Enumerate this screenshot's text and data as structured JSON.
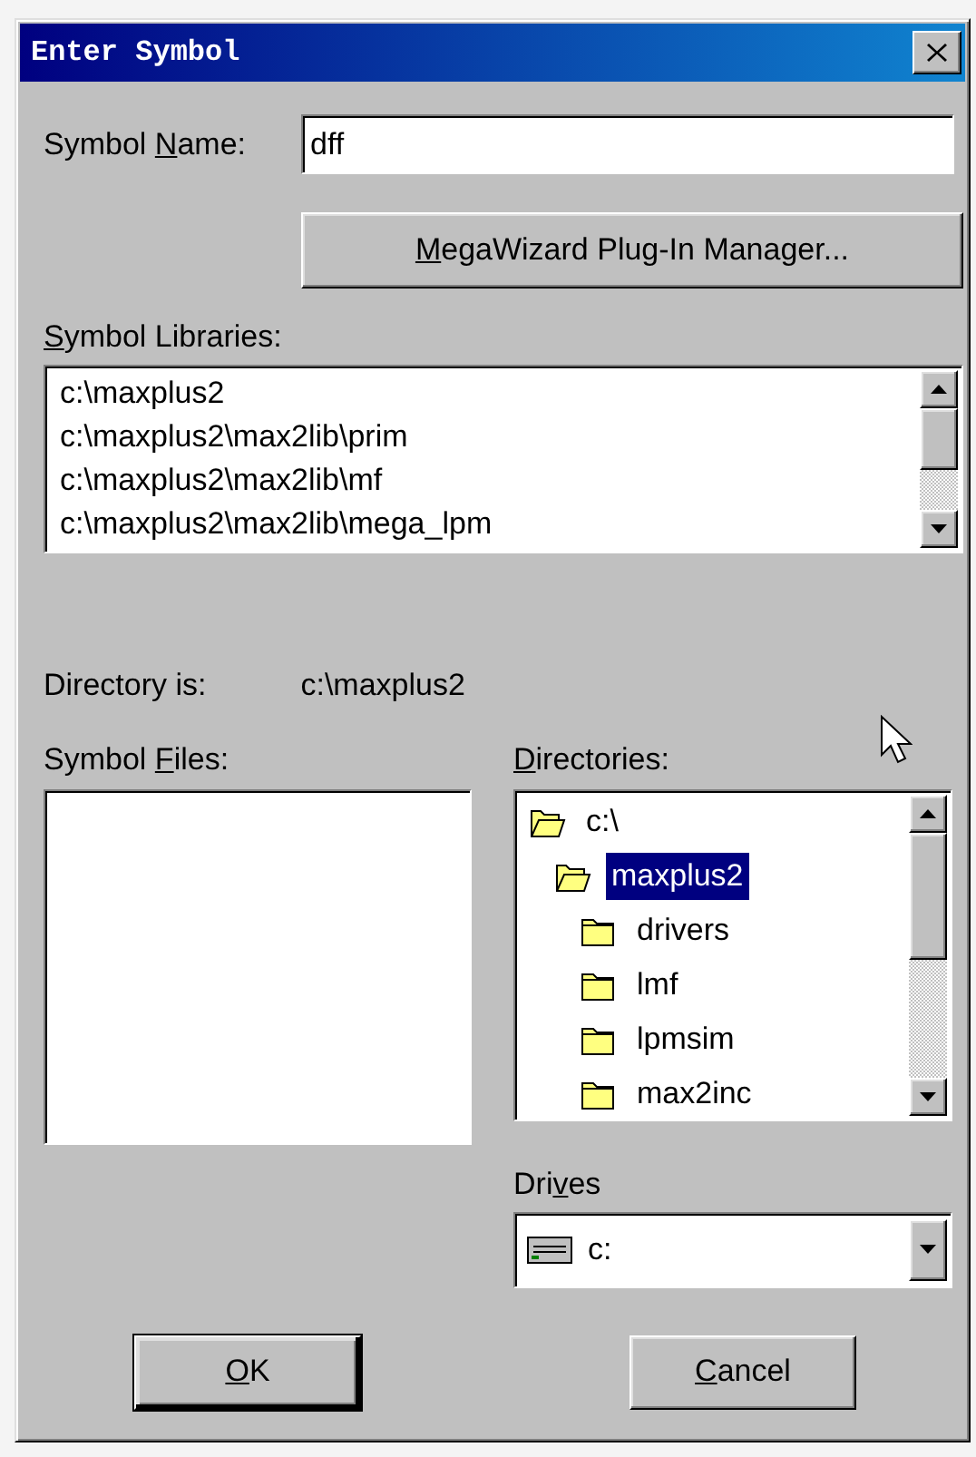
{
  "window": {
    "title": "Enter Symbol"
  },
  "symbol_name": {
    "label": {
      "pre": "Symbol ",
      "key": "N",
      "post": "ame:"
    },
    "value": "dff"
  },
  "megawizard_button": {
    "key": "M",
    "post": "egaWizard Plug-In Manager..."
  },
  "symbol_libraries": {
    "label": {
      "key": "S",
      "post": "ymbol Libraries:"
    },
    "items": [
      {
        "label": "c:\\maxplus2",
        "selected": false
      },
      {
        "label": "c:\\maxplus2\\max2lib\\prim",
        "selected": false
      },
      {
        "label": "c:\\maxplus2\\max2lib\\mf",
        "selected": false
      },
      {
        "label": "c:\\maxplus2\\max2lib\\mega_lpm",
        "selected": false
      }
    ]
  },
  "directory": {
    "label": "Directory is:",
    "value": "c:\\maxplus2"
  },
  "symbol_files": {
    "label": {
      "pre": "Symbol ",
      "key": "F",
      "post": "iles:"
    }
  },
  "directories": {
    "label": {
      "key": "D",
      "post": "irectories:"
    },
    "items": [
      {
        "label": "c:\\",
        "open": true,
        "selected": false,
        "children": [
          {
            "label": "maxplus2",
            "open": true,
            "selected": true,
            "children": [
              {
                "label": "drivers",
                "open": false,
                "selected": false
              },
              {
                "label": "lmf",
                "open": false,
                "selected": false
              },
              {
                "label": "lpmsim",
                "open": false,
                "selected": false
              },
              {
                "label": "max2inc",
                "open": false,
                "selected": false
              }
            ]
          }
        ]
      }
    ]
  },
  "drives": {
    "label": {
      "pre": "Dri",
      "key": "v",
      "post": "es"
    },
    "value": "c:"
  },
  "buttons": [
    {
      "key": "O",
      "post": "K",
      "default": true
    },
    {
      "key": "C",
      "post": "ancel",
      "default": false
    }
  ]
}
